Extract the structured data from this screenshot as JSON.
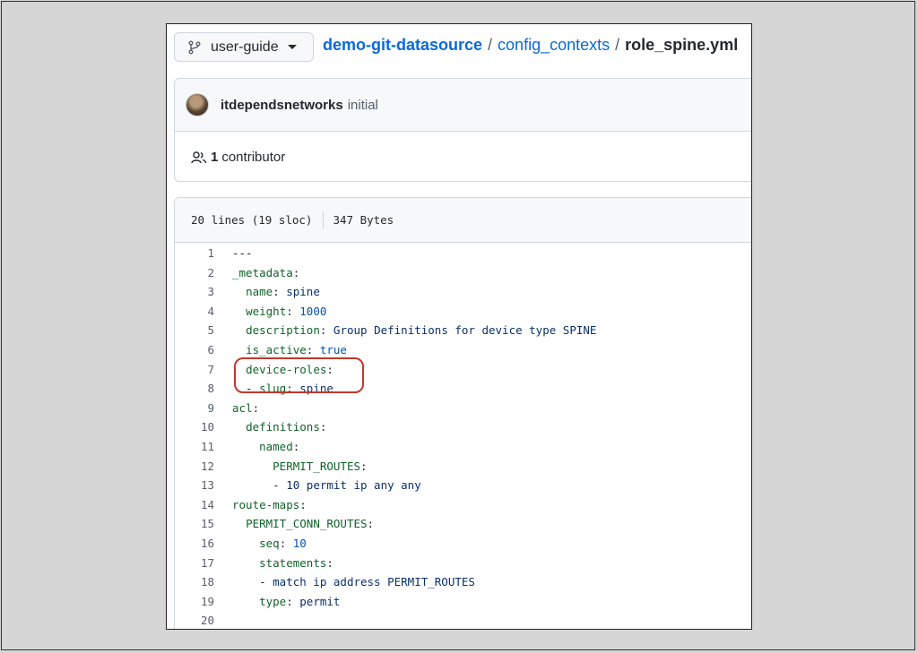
{
  "branch": {
    "name": "user-guide"
  },
  "breadcrumb": {
    "repo": "demo-git-datasource",
    "folder": "config_contexts",
    "separator": "/",
    "file": "role_spine.yml"
  },
  "commit": {
    "author": "itdependsnetworks",
    "message": "initial"
  },
  "contributors": {
    "count": "1",
    "label": "contributor"
  },
  "file_info": {
    "lines": "20 lines (19 sloc)",
    "size": "347 Bytes"
  },
  "code_lines": [
    {
      "n": "1",
      "indent": "",
      "key": "",
      "colon": "",
      "value": "---",
      "value_type": "p"
    },
    {
      "n": "2",
      "indent": "",
      "key": "_metadata",
      "colon": ":",
      "value": "",
      "value_type": "s"
    },
    {
      "n": "3",
      "indent": "  ",
      "key": "name",
      "colon": ":",
      "value": " spine",
      "value_type": "s"
    },
    {
      "n": "4",
      "indent": "  ",
      "key": "weight",
      "colon": ":",
      "value": " 1000",
      "value_type": "n"
    },
    {
      "n": "5",
      "indent": "  ",
      "key": "description",
      "colon": ":",
      "value": " Group Definitions for device type SPINE",
      "value_type": "s"
    },
    {
      "n": "6",
      "indent": "  ",
      "key": "is_active",
      "colon": ":",
      "value": " true",
      "value_type": "n"
    },
    {
      "n": "7",
      "indent": "  ",
      "key": "device-roles",
      "colon": ":",
      "value": "",
      "value_type": "s"
    },
    {
      "n": "8",
      "indent": "  - ",
      "key": "slug",
      "colon": ":",
      "value": " spine",
      "value_type": "s"
    },
    {
      "n": "9",
      "indent": "",
      "key": "acl",
      "colon": ":",
      "value": "",
      "value_type": "s"
    },
    {
      "n": "10",
      "indent": "  ",
      "key": "definitions",
      "colon": ":",
      "value": "",
      "value_type": "s"
    },
    {
      "n": "11",
      "indent": "    ",
      "key": "named",
      "colon": ":",
      "value": "",
      "value_type": "s"
    },
    {
      "n": "12",
      "indent": "      ",
      "key": "PERMIT_ROUTES",
      "colon": ":",
      "value": "",
      "value_type": "s"
    },
    {
      "n": "13",
      "indent": "      - ",
      "key": "",
      "colon": "",
      "value": "10 permit ip any any",
      "value_type": "s"
    },
    {
      "n": "14",
      "indent": "",
      "key": "route-maps",
      "colon": ":",
      "value": "",
      "value_type": "s"
    },
    {
      "n": "15",
      "indent": "  ",
      "key": "PERMIT_CONN_ROUTES",
      "colon": ":",
      "value": "",
      "value_type": "s"
    },
    {
      "n": "16",
      "indent": "    ",
      "key": "seq",
      "colon": ":",
      "value": " 10",
      "value_type": "n"
    },
    {
      "n": "17",
      "indent": "    ",
      "key": "statements",
      "colon": ":",
      "value": "",
      "value_type": "s"
    },
    {
      "n": "18",
      "indent": "    - ",
      "key": "",
      "colon": "",
      "value": "match ip address PERMIT_ROUTES",
      "value_type": "s"
    },
    {
      "n": "19",
      "indent": "    ",
      "key": "type",
      "colon": ":",
      "value": " permit",
      "value_type": "s"
    },
    {
      "n": "20",
      "indent": "",
      "key": "",
      "colon": "",
      "value": "",
      "value_type": "s"
    }
  ],
  "highlighted_lines": [
    "7",
    "8"
  ],
  "colors": {
    "link": "#0969da",
    "yaml_key": "#116329",
    "yaml_string": "#0a3069",
    "yaml_number": "#0550ae",
    "annotation": "#c0392b"
  }
}
